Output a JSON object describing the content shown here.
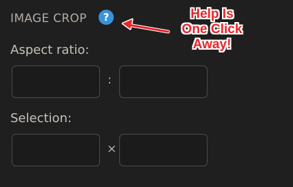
{
  "panel": {
    "title": "IMAGE CROP",
    "help_glyph": "?",
    "help_icon": "question-mark-circle-icon",
    "help_color": "#3a92d9"
  },
  "aspect_ratio": {
    "label": "Aspect ratio:",
    "width_value": "",
    "height_value": "",
    "separator": ":"
  },
  "selection": {
    "label": "Selection:",
    "width_value": "",
    "height_value": "",
    "separator": "×"
  },
  "annotation": {
    "lines": [
      "Help Is",
      "One Click",
      "Away!"
    ],
    "color": "#e8262a",
    "arrow_icon": "red-arrow-icon"
  }
}
